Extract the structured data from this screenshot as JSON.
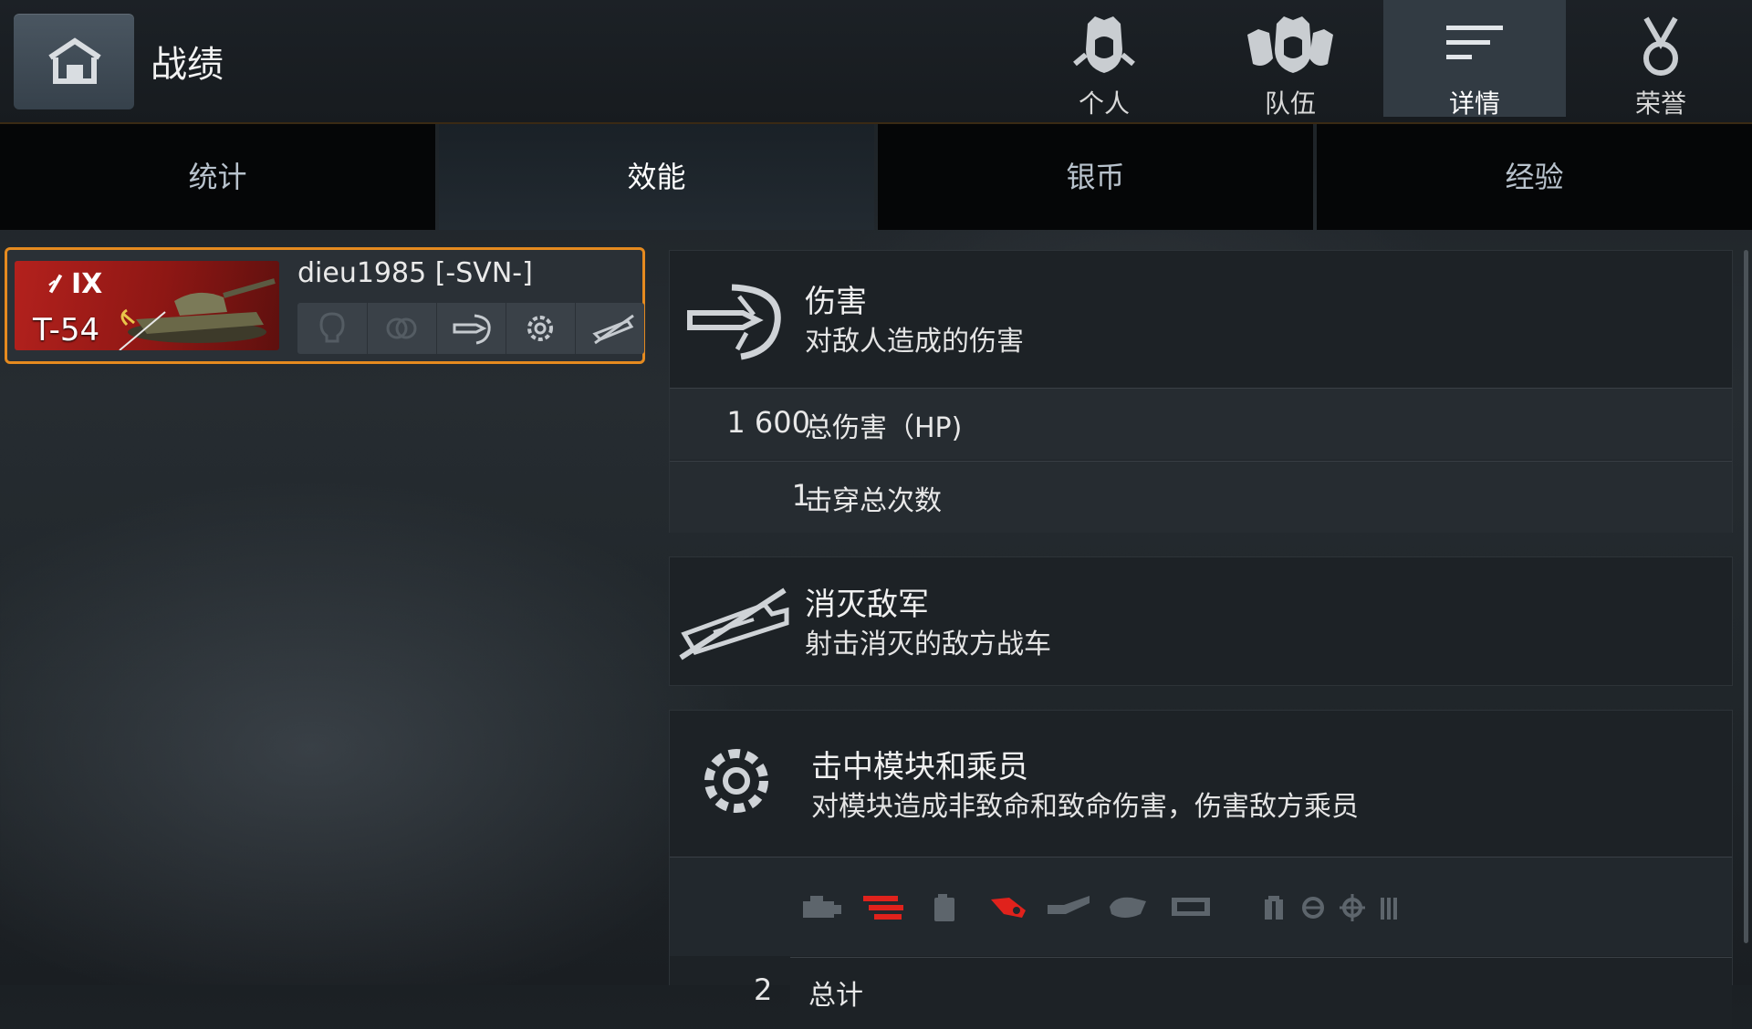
{
  "header": {
    "title": "战绩",
    "tabs": [
      {
        "label": "个人",
        "icon": "crew-single-icon",
        "active": false
      },
      {
        "label": "队伍",
        "icon": "crew-team-icon",
        "active": false
      },
      {
        "label": "详情",
        "icon": "list-lines-icon",
        "active": true
      },
      {
        "label": "荣誉",
        "icon": "medal-icon",
        "active": false
      }
    ]
  },
  "subtabs": [
    {
      "label": "统计",
      "active": false
    },
    {
      "label": "效能",
      "active": true
    },
    {
      "label": "银币",
      "active": false
    },
    {
      "label": "经验",
      "active": false
    }
  ],
  "player": {
    "tier": "IX",
    "tank": "T-54",
    "name": "dieu1985 [-SVN-]",
    "achievements": [
      "spotting-icon",
      "assist-icon",
      "damage-icon",
      "module-icon",
      "kill-icon"
    ]
  },
  "damage": {
    "title": "伤害",
    "subtitle": "对敌人造成的伤害",
    "rows": [
      {
        "value": "1 600",
        "label": "总伤害（HP)"
      },
      {
        "value": "1",
        "label": "击穿总次数"
      }
    ]
  },
  "kills": {
    "title": "消灭敌军",
    "subtitle": "射击消灭的敌方战车"
  },
  "modules": {
    "title": "击中模块和乘员",
    "subtitle": "对模块造成非致命和致命伤害，伤害敌方乘员",
    "icons": [
      {
        "name": "engine-icon",
        "hit": false
      },
      {
        "name": "ammo-rack-icon",
        "hit": true
      },
      {
        "name": "fuel-tank-icon",
        "hit": false
      },
      {
        "name": "gun-icon",
        "hit": true
      },
      {
        "name": "tracks-icon",
        "hit": false
      },
      {
        "name": "turret-icon",
        "hit": false
      },
      {
        "name": "radio-icon",
        "hit": false
      },
      {
        "name": "commander-icon",
        "hit": false
      },
      {
        "name": "driver-icon",
        "hit": false
      },
      {
        "name": "gunner-icon",
        "hit": false
      },
      {
        "name": "loader-icon",
        "hit": false
      }
    ],
    "total_value": "2",
    "total_label": "总计"
  },
  "colors": {
    "accent": "#e58a1f",
    "hit": "#e0221c",
    "inactive": "#5d656c"
  }
}
